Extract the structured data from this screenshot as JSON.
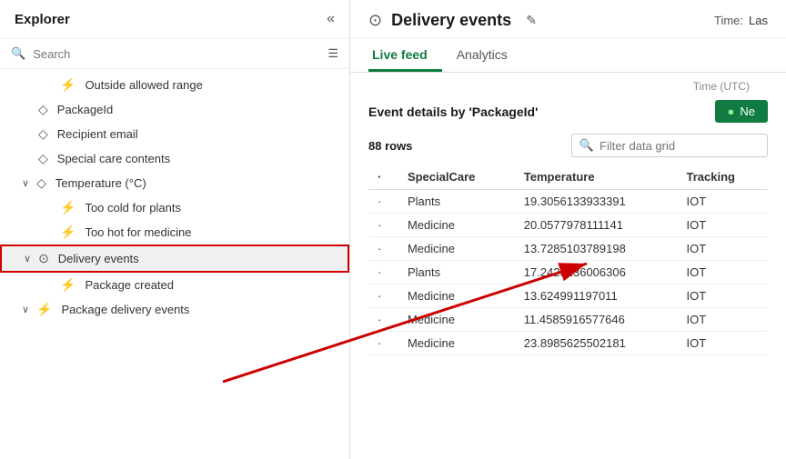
{
  "sidebar": {
    "title": "Explorer",
    "search_placeholder": "Search",
    "collapse_icon": "«",
    "tree_items": [
      {
        "id": "outside-range",
        "label": "Outside allowed range",
        "icon": "⚡",
        "indent": "indent2",
        "expand": ""
      },
      {
        "id": "packageid",
        "label": "PackageId",
        "icon": "◇",
        "indent": "indent1",
        "expand": ""
      },
      {
        "id": "recipient-email",
        "label": "Recipient email",
        "icon": "◇",
        "indent": "indent1",
        "expand": ""
      },
      {
        "id": "special-care",
        "label": "Special care contents",
        "icon": "◇",
        "indent": "indent1",
        "expand": ""
      },
      {
        "id": "temperature",
        "label": "Temperature (°C)",
        "icon": "◇",
        "indent": "indent1",
        "expand": "∨"
      },
      {
        "id": "too-cold",
        "label": "Too cold for plants",
        "icon": "⚡",
        "indent": "indent2",
        "expand": ""
      },
      {
        "id": "too-hot",
        "label": "Too hot for medicine",
        "icon": "⚡",
        "indent": "indent2",
        "expand": ""
      },
      {
        "id": "delivery-events",
        "label": "Delivery events",
        "icon": "⊙",
        "indent": "indent1",
        "expand": "∨",
        "highlighted": true
      },
      {
        "id": "package-created",
        "label": "Package created",
        "icon": "⚡",
        "indent": "indent2",
        "expand": ""
      },
      {
        "id": "package-delivery",
        "label": "Package delivery events",
        "icon": "⚡",
        "indent": "indent1",
        "expand": "∨"
      }
    ]
  },
  "main": {
    "title": "Delivery events",
    "title_icon": "⊙",
    "edit_icon": "✎",
    "time_label": "Time:",
    "time_value": "Las",
    "tabs": [
      {
        "id": "live-feed",
        "label": "Live feed",
        "active": true
      },
      {
        "id": "analytics",
        "label": "Analytics",
        "active": false
      }
    ],
    "time_utc": "Time (UTC)",
    "event_details_title": "Event details by 'PackageId'",
    "new_btn_label": "Ne",
    "rows_count": "88 rows",
    "filter_placeholder": "Filter data grid",
    "table": {
      "columns": [
        "SpecialCare",
        "Temperature",
        "Tracking"
      ],
      "rows": [
        {
          "specialcare": "Plants",
          "temperature": "19.3056133933391",
          "tracking": "IOT"
        },
        {
          "specialcare": "Medicine",
          "temperature": "20.0577978111141",
          "tracking": "IOT"
        },
        {
          "specialcare": "Medicine",
          "temperature": "13.7285103789198",
          "tracking": "IOT"
        },
        {
          "specialcare": "Plants",
          "temperature": "17.2423136006306",
          "tracking": "IOT"
        },
        {
          "specialcare": "Medicine",
          "temperature": "13.624991197011",
          "tracking": "IOT"
        },
        {
          "specialcare": "Medicine",
          "temperature": "11.4585916577646",
          "tracking": "IOT"
        },
        {
          "specialcare": "Medicine",
          "temperature": "23.8985625502181",
          "tracking": "IOT"
        }
      ]
    }
  },
  "icons": {
    "search": "🔍",
    "filter": "☰",
    "new_dot": "●"
  }
}
